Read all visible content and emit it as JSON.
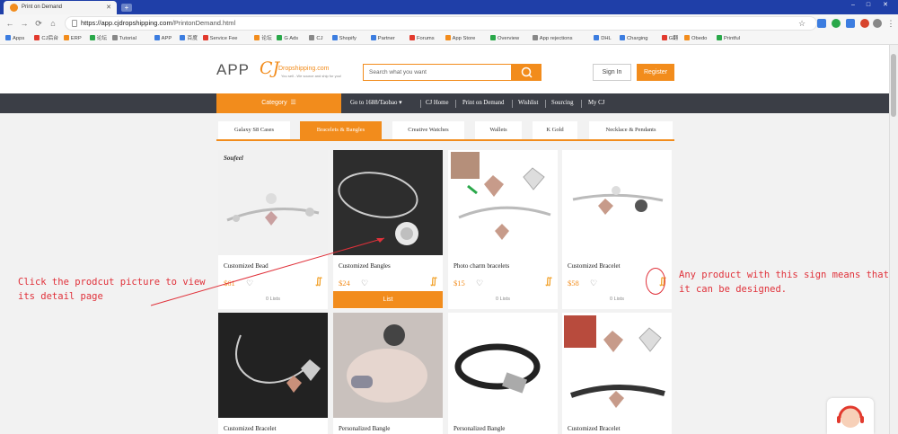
{
  "browser": {
    "tab_title": "Print on Demand",
    "url_host": "https://app.cjdropshipping.com",
    "url_path": "/PrintonDemand.html",
    "bookmarks": [
      "Apps",
      "CJ后台",
      "ERP",
      "论坛",
      "Tutorial",
      "APP",
      "百度",
      "Service Fee",
      "论坛",
      "G Ads",
      "CJ",
      "Shopify",
      "Partner",
      "Forums",
      "App Store",
      "Overview",
      "App rejections",
      "DHL",
      "Charging",
      "G翻",
      "Obedo",
      "Printful"
    ]
  },
  "header": {
    "logo_app": "APP",
    "logo_cj": "CJ",
    "logo_sub": "Dropshipping.com",
    "logo_tagline": "You sell - We source and ship for you!",
    "search_placeholder": "Search what you want",
    "signin": "Sign In",
    "register": "Register"
  },
  "nav": {
    "category": "Category",
    "links": [
      "Go to 1688/Taobao",
      "CJ Home",
      "Print on Demand",
      "Wishlist",
      "Sourcing",
      "My CJ"
    ]
  },
  "category_tabs": [
    "Galaxy S8 Cases",
    "Bracelets & Bangles",
    "Creative Watches",
    "Wallets",
    "K Gold",
    "Necklace & Pendants"
  ],
  "products_row1": [
    {
      "name": "Customized Bead",
      "price": "$61",
      "lists": "0 Lists",
      "brand": "Soufeel"
    },
    {
      "name": "Customized Bangles",
      "price": "$24",
      "lists": "List"
    },
    {
      "name": "Photo charm bracelets",
      "price": "$15",
      "lists": "0 Lists"
    },
    {
      "name": "Customized Bracelet",
      "price": "$58",
      "lists": "0 Lists"
    }
  ],
  "products_row2": [
    {
      "name": "Customized Bracelet"
    },
    {
      "name": "Personalized Bangle"
    },
    {
      "name": "Personalized Bangle"
    },
    {
      "name": "Customized Bracelet"
    }
  ],
  "annotations": {
    "left_line1": "Click the prodcut picture to view",
    "left_line2": "its detail page",
    "right_line1": "Any product with this sign means that",
    "right_line2": "it can be designed."
  },
  "colors": {
    "accent": "#f28c1c",
    "nav_bg": "#3b3e46",
    "annotation": "#e0313a"
  }
}
